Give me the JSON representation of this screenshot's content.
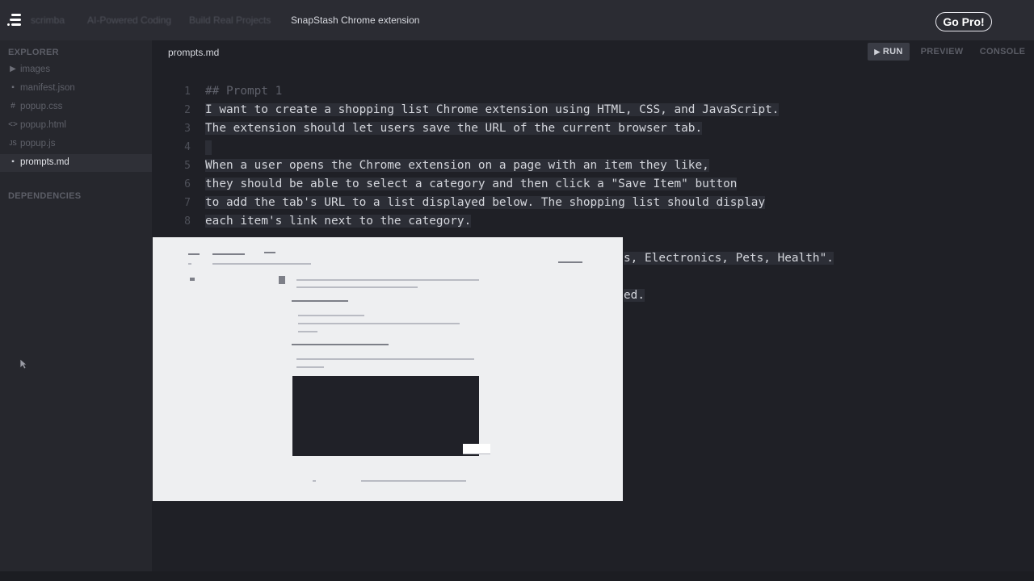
{
  "topbar": {
    "logo_icon": "scrimba-logo-icon",
    "crumbs": [
      "scrimba",
      "AI-Powered Coding",
      "Build Real Projects",
      "SnapStash Chrome extension"
    ],
    "gopro_label": "Go Pro!"
  },
  "sidebar": {
    "explorer_heading": "EXPLORER",
    "items": [
      {
        "icon": "folder-arrow-icon",
        "glyph": "▶",
        "label": "images"
      },
      {
        "icon": "file-icon",
        "glyph": "▪",
        "label": "manifest.json"
      },
      {
        "icon": "css-icon",
        "glyph": "#",
        "label": "popup.css"
      },
      {
        "icon": "html-icon",
        "glyph": "<>",
        "label": "popup.html"
      },
      {
        "icon": "js-icon",
        "glyph": "JS",
        "label": "popup.js"
      },
      {
        "icon": "markdown-icon",
        "glyph": "▪",
        "label": "prompts.md"
      }
    ],
    "dependencies_heading": "DEPENDENCIES"
  },
  "editor": {
    "file_tab": "prompts.md",
    "run_label": "RUN",
    "preview_label": "PREVIEW",
    "console_label": "CONSOLE",
    "lines": [
      {
        "n": "1",
        "text": "## Prompt 1"
      },
      {
        "n": "2",
        "text": "I want to create a shopping list Chrome extension using HTML, CSS, and JavaScript."
      },
      {
        "n": "3",
        "text": "The extension should let users save the URL of the current browser tab."
      },
      {
        "n": "4",
        "text": ""
      },
      {
        "n": "5",
        "text": "When a user opens the Chrome extension on a page with an item they like,"
      },
      {
        "n": "6",
        "text": "they should be able to select a category and then click a \"Save Item\" button"
      },
      {
        "n": "7",
        "text": "to add the tab's URL to a list displayed below. The shopping list should display"
      },
      {
        "n": "8",
        "text": "each item's link next to the category."
      }
    ],
    "partial_line_10": "s, Electronics, Pets, Health\".",
    "partial_line_12": "ed."
  },
  "colors": {
    "background": "#1f2026",
    "topbar": "#2b2c33",
    "sidebar": "#26272d",
    "selection": "#2c2e36",
    "overlay": "#eeeff1"
  }
}
